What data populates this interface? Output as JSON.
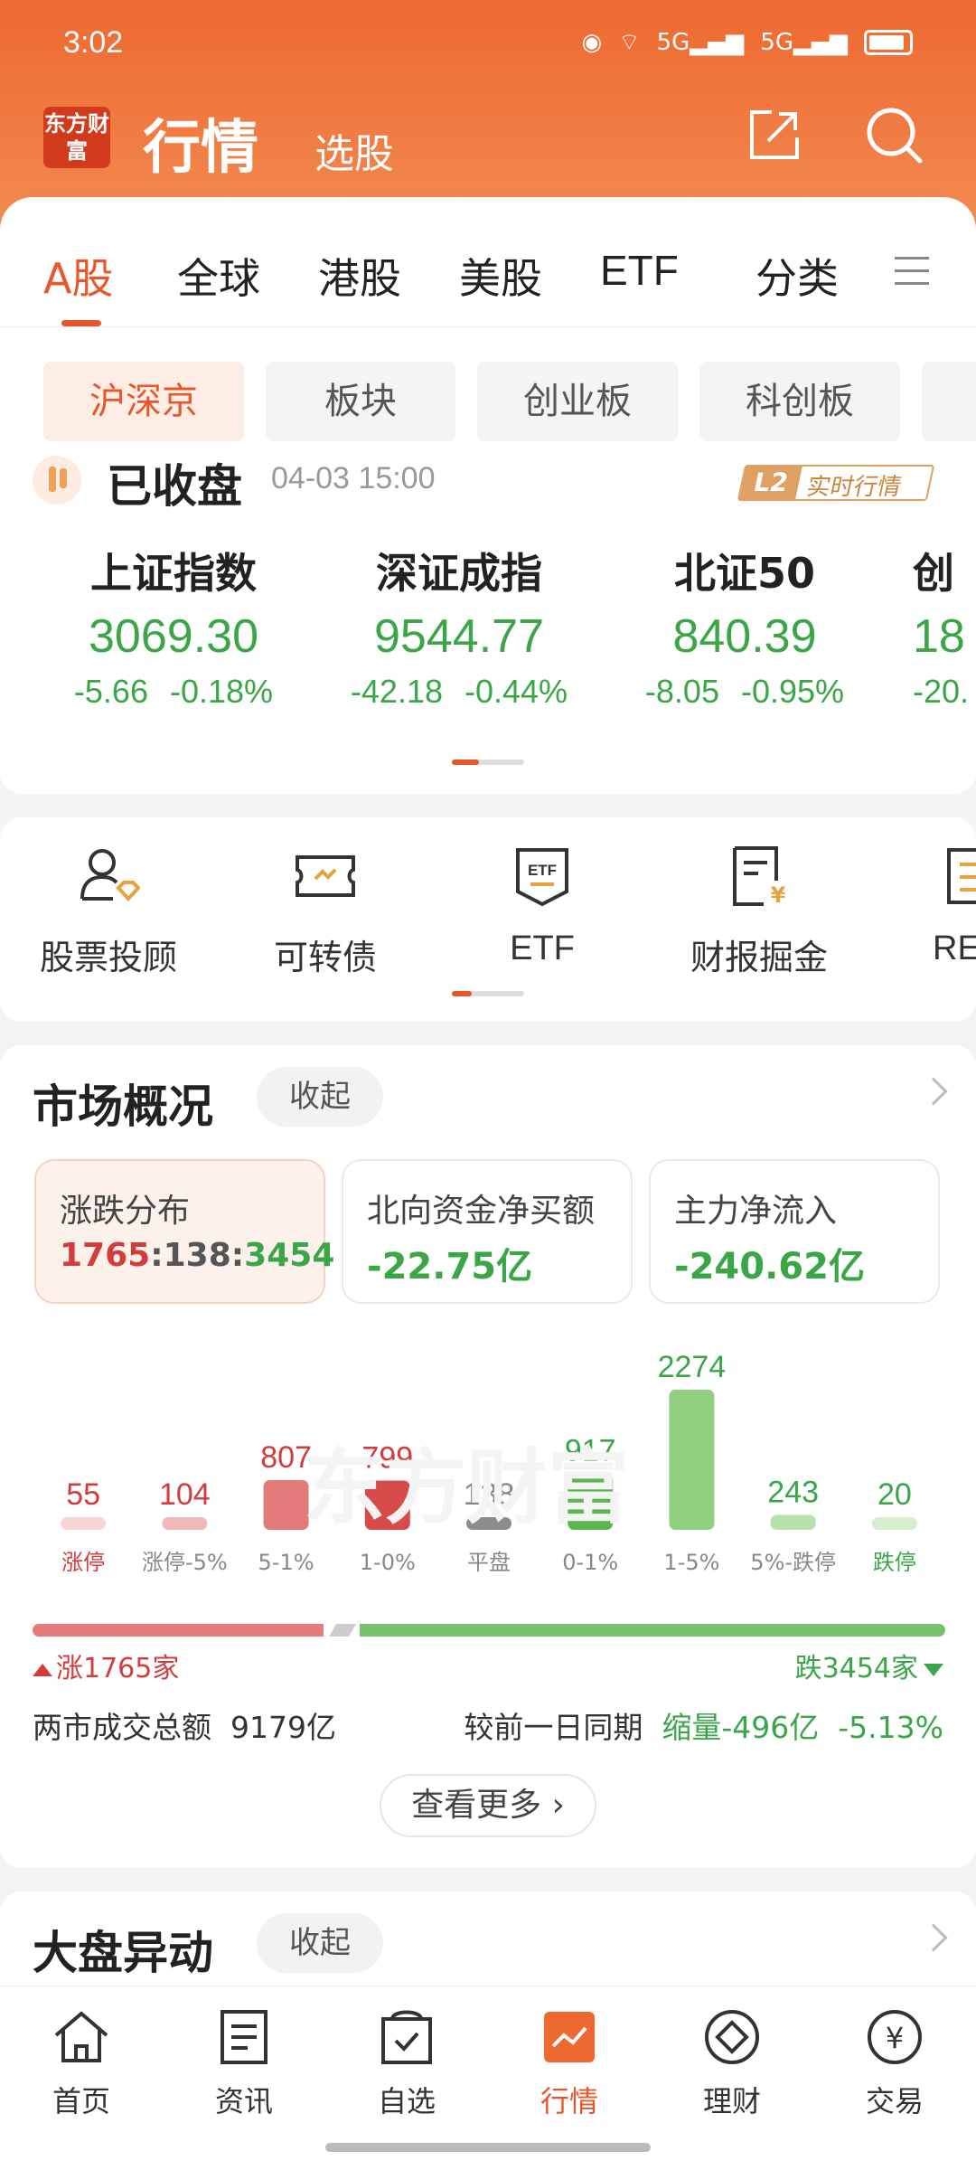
{
  "status_bar": {
    "time": "3:02",
    "signal_1": "5G",
    "signal_2": "5G"
  },
  "header": {
    "logo_text": "东方财富",
    "title": "行情",
    "subtitle": "选股"
  },
  "tabs": [
    "A股",
    "全球",
    "港股",
    "美股",
    "ETF",
    "分类"
  ],
  "subtabs": [
    "沪深京",
    "板块",
    "创业板",
    "科创板"
  ],
  "market_status": {
    "text": "已收盘",
    "time": "04-03 15:00",
    "l2_label": "L2",
    "l2_text": "实时行情"
  },
  "indices": [
    {
      "name": "上证指数",
      "value": "3069.30",
      "change": "-5.66",
      "pct": "-0.18%"
    },
    {
      "name": "深证成指",
      "value": "9544.77",
      "change": "-42.18",
      "pct": "-0.44%"
    },
    {
      "name": "北证50",
      "value": "840.39",
      "change": "-8.05",
      "pct": "-0.95%"
    },
    {
      "name": "创",
      "value": "18",
      "change": "-20.",
      "pct": ""
    }
  ],
  "tools": [
    {
      "label": "股票投顾",
      "icon": "advisor-icon"
    },
    {
      "label": "可转债",
      "icon": "bond-icon"
    },
    {
      "label": "ETF",
      "icon": "etf-icon"
    },
    {
      "label": "财报掘金",
      "icon": "report-icon"
    },
    {
      "label": "RE",
      "icon": "re-icon"
    }
  ],
  "overview": {
    "title": "市场概况",
    "collapse": "收起",
    "stats": [
      {
        "label": "涨跌分布",
        "up": "1765",
        "flat": "138",
        "down": "3454"
      },
      {
        "label": "北向资金净买额",
        "value": "-22.75亿"
      },
      {
        "label": "主力净流入",
        "value": "-240.62亿"
      }
    ],
    "up_label": "涨1765家",
    "down_label": "跌3454家",
    "turnover_label": "两市成交总额",
    "turnover_value": "9179亿",
    "compare_label": "较前一日同期",
    "compare_value": "缩量-496亿",
    "compare_pct": "-5.13%",
    "more": "查看更多"
  },
  "chart_data": {
    "type": "bar",
    "categories": [
      "涨停",
      "涨停-5%",
      "5-1%",
      "1-0%",
      "平盘",
      "0-1%",
      "1-5%",
      "5%-跌停",
      "跌停"
    ],
    "values": [
      55,
      104,
      807,
      799,
      138,
      917,
      2274,
      243,
      20
    ],
    "colors": [
      "#f6d5d5",
      "#f0b8b8",
      "#e27a7a",
      "#d84b4b",
      "#8c8c8c",
      "#5cb54e",
      "#8fcf7f",
      "#b9e1ab",
      "#d6eecd"
    ],
    "value_colors": [
      "#d33c3c",
      "#d33c3c",
      "#d33c3c",
      "#d33c3c",
      "#888888",
      "#3aa648",
      "#3aa648",
      "#3aa648",
      "#3aa648"
    ],
    "watermark": "东方财富"
  },
  "movement": {
    "title": "大盘异动",
    "collapse": "收起"
  },
  "bottom_nav": [
    {
      "label": "首页",
      "icon": "home-icon"
    },
    {
      "label": "资讯",
      "icon": "news-icon"
    },
    {
      "label": "自选",
      "icon": "watchlist-icon"
    },
    {
      "label": "行情",
      "icon": "market-icon"
    },
    {
      "label": "理财",
      "icon": "wealth-icon"
    },
    {
      "label": "交易",
      "icon": "trade-icon"
    }
  ],
  "colors": {
    "accent": "#e8562a",
    "up": "#d33c3c",
    "down": "#3aa648"
  }
}
